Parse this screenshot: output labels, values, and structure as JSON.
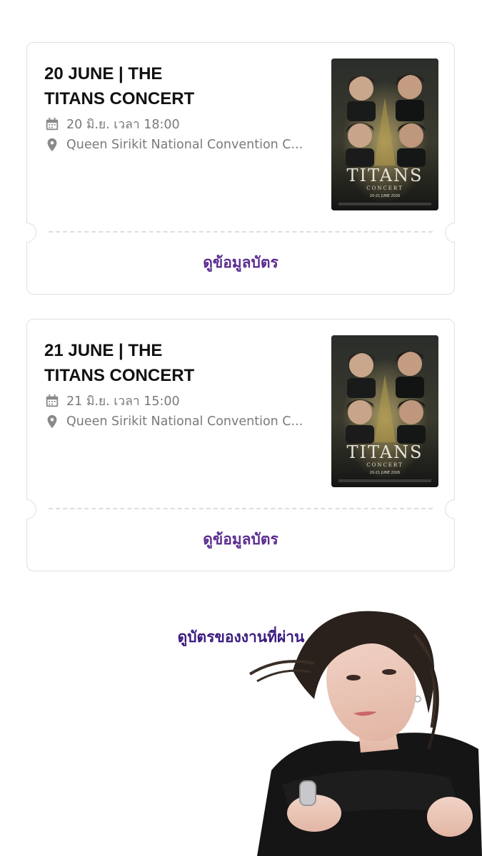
{
  "tickets": [
    {
      "title_line1": "20 JUNE | THE",
      "title_line2": "TITANS CONCERT",
      "date": "20 มิ.ย. เวลา 18:00",
      "venue": "Queen Sirikit National Convention C...",
      "poster_title": "TITANS",
      "poster_subtitle": "CONCERT",
      "poster_date": "20-21 JUNE 2026",
      "view_label": "ดูข้อมูลบัตร"
    },
    {
      "title_line1": "21 JUNE | THE",
      "title_line2": "TITANS CONCERT",
      "date": "21 มิ.ย. เวลา 15:00",
      "venue": "Queen Sirikit National Convention C...",
      "poster_title": "TITANS",
      "poster_subtitle": "CONCERT",
      "poster_date": "20-21 JUNE 2026",
      "view_label": "ดูข้อมูลบัตร"
    }
  ],
  "past_events_label": "ดูบัตรของงานที่ผ่าน",
  "icons": {
    "date": "calendar-icon",
    "venue": "location-pin-icon"
  },
  "colors": {
    "accent": "#5b2d90",
    "muted_text": "#7a7a7a",
    "border": "#e0e0e4"
  }
}
